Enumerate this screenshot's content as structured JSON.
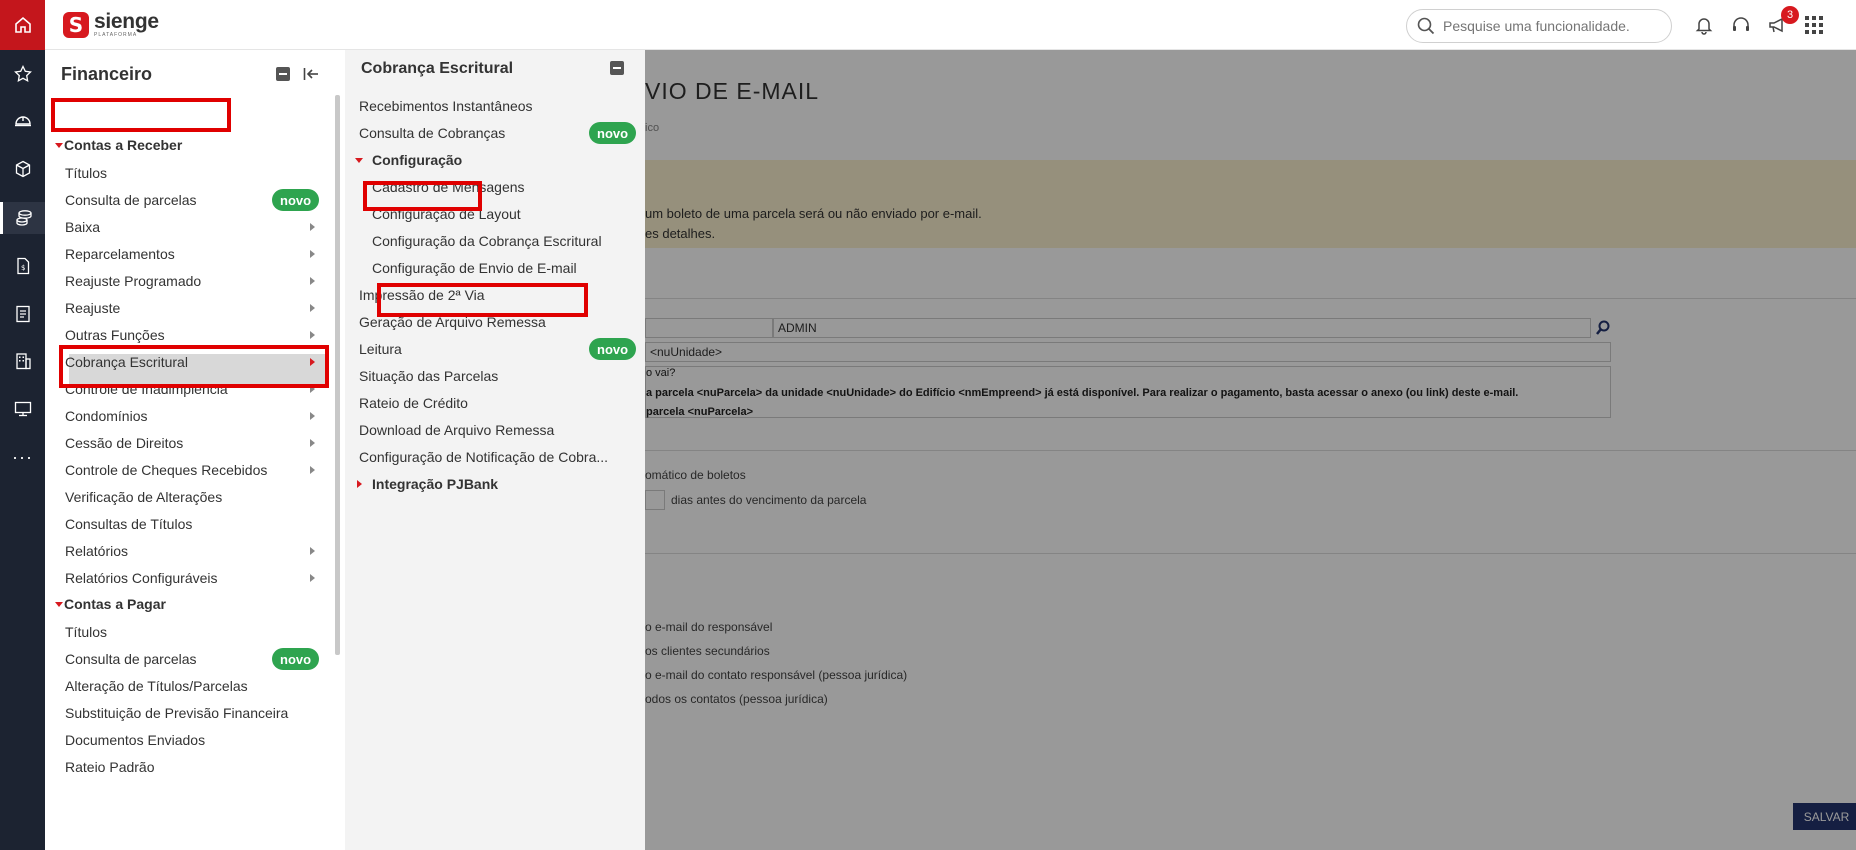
{
  "header": {
    "logo_name": "sienge",
    "logo_sub": "PLATAFORMA",
    "search_placeholder": "Pesquise uma funcionalidade.",
    "notification_count": "3"
  },
  "rail": {
    "icons": [
      "home-icon",
      "star-icon",
      "helmet-icon",
      "cube-icon",
      "coins-icon",
      "document-icon",
      "report-icon",
      "building-icon",
      "monitor-icon",
      "more-icon"
    ],
    "active": "coins-icon"
  },
  "financeiro": {
    "title": "Financeiro",
    "contas_receber": {
      "label": "Contas a Receber",
      "items": [
        {
          "label": "Títulos"
        },
        {
          "label": "Consulta de parcelas",
          "badge": "novo"
        },
        {
          "label": "Baixa"
        },
        {
          "label": "Reparcelamentos"
        },
        {
          "label": "Reajuste Programado"
        },
        {
          "label": "Reajuste"
        },
        {
          "label": "Outras Funções"
        },
        {
          "label": "Cobrança Escritural"
        },
        {
          "label": "Controle de Inadimplência"
        },
        {
          "label": "Condomínios"
        },
        {
          "label": "Cessão de Direitos"
        },
        {
          "label": "Controle de Cheques Recebidos"
        },
        {
          "label": "Verificação de Alterações"
        },
        {
          "label": "Consultas de Títulos"
        },
        {
          "label": "Relatórios"
        },
        {
          "label": "Relatórios Configuráveis"
        }
      ]
    },
    "contas_pagar": {
      "label": "Contas a Pagar",
      "items": [
        {
          "label": "Títulos"
        },
        {
          "label": "Consulta de parcelas",
          "badge": "novo"
        },
        {
          "label": "Alteração de Títulos/Parcelas"
        },
        {
          "label": "Substituição de Previsão Financeira"
        },
        {
          "label": "Documentos Enviados"
        },
        {
          "label": "Rateio Padrão"
        }
      ]
    }
  },
  "cobranca": {
    "title": "Cobrança Escritural",
    "items": [
      {
        "label": "Recebimentos Instantâneos"
      },
      {
        "label": "Consulta de Cobranças",
        "badge": "novo"
      },
      {
        "label": "Configuração"
      },
      {
        "label": "Cadastro de Mensagens"
      },
      {
        "label": "Configuração de Layout"
      },
      {
        "label": "Configuração da Cobrança Escritural"
      },
      {
        "label": "Configuração de Envio de E-mail"
      },
      {
        "label": "Impressão de 2ª Via"
      },
      {
        "label": "Geração de Arquivo Remessa"
      },
      {
        "label": "Leitura",
        "badge": "novo"
      },
      {
        "label": "Situação das Parcelas"
      },
      {
        "label": "Rateio de Crédito"
      },
      {
        "label": "Download de Arquivo Remessa"
      },
      {
        "label": "Configuração de Notificação de Cobra..."
      },
      {
        "label": "Integração PJBank"
      }
    ]
  },
  "background": {
    "title": "VIO DE E-MAIL",
    "crumb": "ico",
    "warn_line1": "um boleto de uma parcela será ou não enviado por e-mail.",
    "warn_line2": "es detalhes.",
    "user_field": "ADMIN",
    "subject_field": "<nuUnidade>",
    "msg_line1": "o vai?",
    "msg_line2": "a parcela <nuParcela> da unidade <nuUnidade> do Edifício <nmEmpreend> já está disponível. Para realizar o pagamento, basta acessar o anexo (ou link) deste e-mail.",
    "msg_line3": "parcela <nuParcela>",
    "auto_label": "omático de boletos",
    "days_label": "dias antes do vencimento da parcela",
    "opt1": "o e-mail do responsável",
    "opt2": "os clientes secundários",
    "opt3": "o e-mail do contato responsável (pessoa jurídica)",
    "opt4": "odos os contatos (pessoa jurídica)",
    "save": "SALVAR"
  },
  "colors": {
    "brand_red": "#d7191f",
    "rail_bg": "#1c2331",
    "badge_green": "#2ea44f",
    "highlight": "#e00000"
  }
}
